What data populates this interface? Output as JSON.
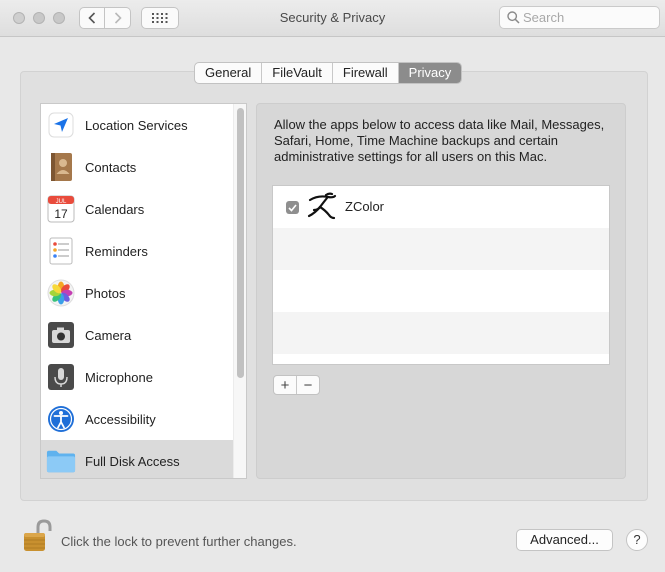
{
  "window": {
    "title": "Security & Privacy",
    "search_placeholder": "Search"
  },
  "tabs": [
    {
      "label": "General",
      "active": false
    },
    {
      "label": "FileVault",
      "active": false
    },
    {
      "label": "Firewall",
      "active": false
    },
    {
      "label": "Privacy",
      "active": true
    }
  ],
  "categories": [
    {
      "label": "Location Services",
      "icon": "location-arrow-icon",
      "selected": false
    },
    {
      "label": "Contacts",
      "icon": "contacts-book-icon",
      "selected": false
    },
    {
      "label": "Calendars",
      "icon": "calendar-icon",
      "selected": false
    },
    {
      "label": "Reminders",
      "icon": "reminders-list-icon",
      "selected": false
    },
    {
      "label": "Photos",
      "icon": "photos-flower-icon",
      "selected": false
    },
    {
      "label": "Camera",
      "icon": "camera-icon",
      "selected": false
    },
    {
      "label": "Microphone",
      "icon": "microphone-icon",
      "selected": false
    },
    {
      "label": "Accessibility",
      "icon": "accessibility-person-icon",
      "selected": false
    },
    {
      "label": "Full Disk Access",
      "icon": "folder-icon",
      "selected": true
    }
  ],
  "calendar_icon": {
    "month": "JUL",
    "day": "17"
  },
  "privacy": {
    "description": "Allow the apps below to access data like Mail, Messages, Safari, Home, Time Machine backups and certain administrative settings for all users on this Mac.",
    "apps": [
      {
        "name": "ZColor",
        "checked": true,
        "icon": "zcolor-running-figure-icon"
      }
    ],
    "add_label": "+",
    "remove_label": "−"
  },
  "footer": {
    "lock_text": "Click the lock to prevent further changes.",
    "advanced_label": "Advanced...",
    "help_label": "?"
  },
  "colors": {
    "accent_blue": "#1a73e8",
    "tab_active": "#8c8c8c",
    "selected_row": "#dadada"
  }
}
